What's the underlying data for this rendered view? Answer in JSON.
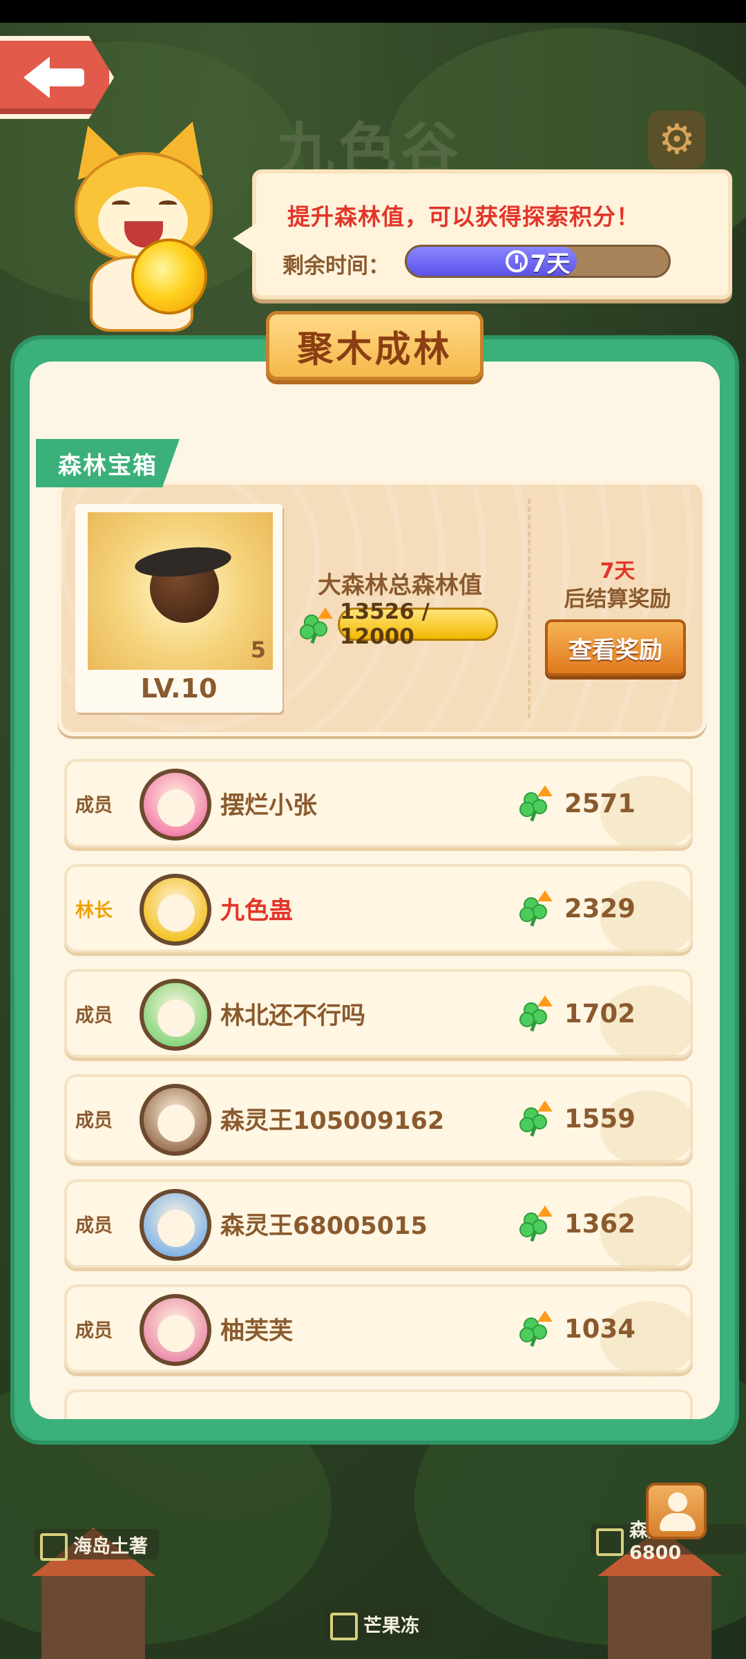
{
  "header": {
    "bg_title": "九色谷"
  },
  "bubble": {
    "message": "提升森林值，可以获得探索积分！",
    "time_label": "剩余时间：",
    "time_remaining": "7天",
    "time_progress": 0.65
  },
  "panel": {
    "title": "聚木成林",
    "treasure": {
      "tag": "森林宝箱",
      "count": "5",
      "level": "LV.10",
      "forest_label": "大森林总森林值",
      "forest_value": "13526 / 12000",
      "settle_days": "7天",
      "settle_text": "后结算奖励",
      "reward_button": "查看奖励"
    },
    "members": [
      {
        "role": "成员",
        "name": "摆烂小张",
        "score": "2571",
        "leader": false,
        "avatar_color": "#f06aa0"
      },
      {
        "role": "林长",
        "name": "九色蛊",
        "score": "2329",
        "leader": true,
        "avatar_color": "#f1b800"
      },
      {
        "role": "成员",
        "name": "林北还不行吗",
        "score": "1702",
        "leader": false,
        "avatar_color": "#6fd06a"
      },
      {
        "role": "成员",
        "name": "森灵王105009162",
        "score": "1559",
        "leader": false,
        "avatar_color": "#8a5a3a"
      },
      {
        "role": "成员",
        "name": "森灵王68005015",
        "score": "1362",
        "leader": false,
        "avatar_color": "#6aa8e8"
      },
      {
        "role": "成员",
        "name": "柚芙芙",
        "score": "1034",
        "leader": false,
        "avatar_color": "#e77aa0"
      }
    ]
  },
  "map": {
    "labels": [
      "海岛土著",
      "芒果冻",
      "森灵王6800"
    ]
  },
  "icons": {
    "back": "back-arrow-icon",
    "settings": "gear-icon",
    "clock": "clock-icon",
    "forest": "clover-up-icon",
    "profile": "avatar-icon"
  }
}
